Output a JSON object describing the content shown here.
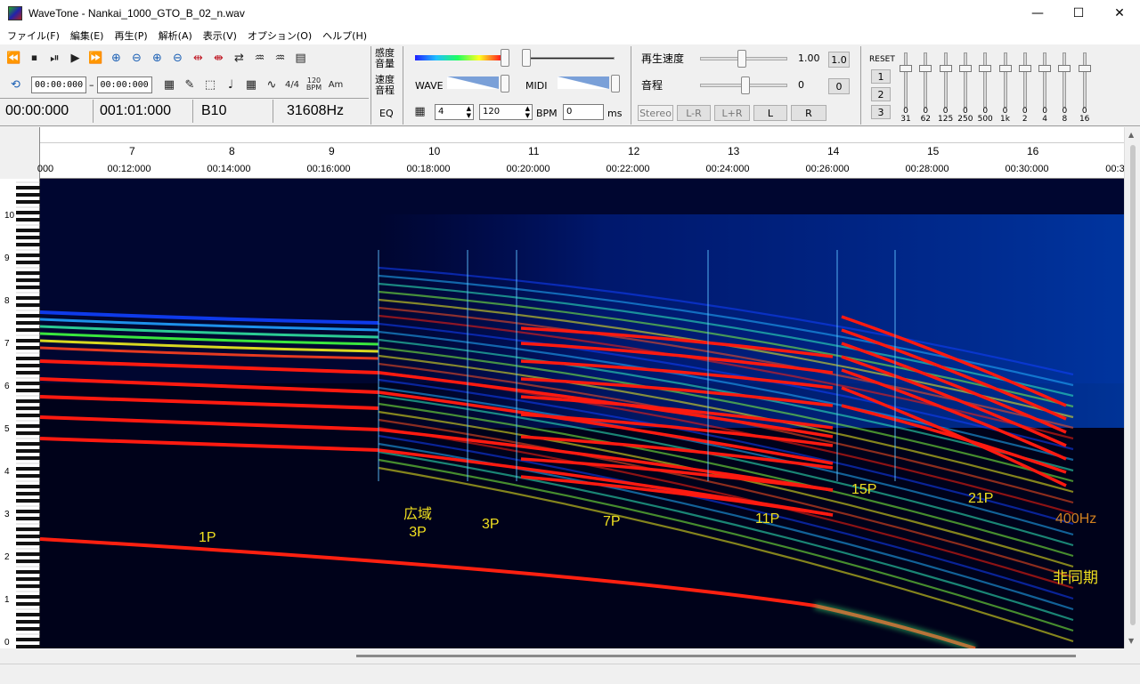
{
  "window": {
    "title": "WaveTone - Nankai_1000_GTO_B_02_n.wav",
    "minimize": "—",
    "maximize": "☐",
    "close": "✕"
  },
  "menu": [
    "ファイル(F)",
    "編集(E)",
    "再生(P)",
    "解析(A)",
    "表示(V)",
    "オプション(O)",
    "ヘルプ(H)"
  ],
  "toolbar": {
    "loop_start": "00:00:000",
    "loop_dash": "–",
    "loop_end": "00:00:000",
    "time_sig": "4/4",
    "tempo_icon": "120 BPM",
    "am_icon": "Am",
    "position": "00:00:000",
    "measure_pos": "001:01:000",
    "note": "B10",
    "freq": "31608Hz"
  },
  "sensitivity": {
    "label_top": "感度",
    "label_bottom": "音量",
    "speed_top": "速度",
    "speed_bottom": "音程",
    "eq_label": "EQ",
    "wave_label": "WAVE",
    "midi_label": "MIDI",
    "beats": "4",
    "bpm": "120",
    "bpm_label": "BPM",
    "ms_value": "0",
    "ms_label": "ms"
  },
  "playback": {
    "speed_label": "再生速度",
    "speed_value": "1.00",
    "speed_reset": "1.0",
    "pitch_label": "音程",
    "pitch_value": "0",
    "pitch_reset": "0",
    "stereo_label": "Stereo",
    "channels": [
      "L-R",
      "L+R",
      "L",
      "R"
    ]
  },
  "eq": {
    "reset": "RESET",
    "presets": [
      "1",
      "2",
      "3"
    ],
    "bands": [
      "31",
      "62",
      "125",
      "250",
      "500",
      "1k",
      "2",
      "4",
      "8",
      "16"
    ],
    "values": [
      "0",
      "0",
      "0",
      "0",
      "0",
      "0",
      "0",
      "0",
      "0",
      "0"
    ]
  },
  "ruler": {
    "measures": [
      "7",
      "8",
      "9",
      "10",
      "11",
      "12",
      "13",
      "14",
      "15",
      "16"
    ],
    "times": [
      "000",
      "00:12:000",
      "00:14:000",
      "00:16:000",
      "00:18:000",
      "00:20:000",
      "00:22:000",
      "00:24:000",
      "00:26:000",
      "00:28:000",
      "00:30:000",
      "00:3"
    ]
  },
  "keyboard": {
    "octaves": [
      "10",
      "9",
      "8",
      "7",
      "6",
      "5",
      "4",
      "3",
      "2",
      "1",
      "0"
    ]
  },
  "annotations": {
    "p1": "1P",
    "wide_line1": "広域",
    "wide_line2": "3P",
    "p3": "3P",
    "p7": "7P",
    "p11": "11P",
    "p15": "15P",
    "p21": "21P",
    "hz400": "400Hz",
    "async": "非同期"
  },
  "colors": {
    "spectrogram_bg": "#000010",
    "strong_line": "#ff1a10",
    "annotation": "#f0e020",
    "annotation_hz": "#d08020"
  }
}
